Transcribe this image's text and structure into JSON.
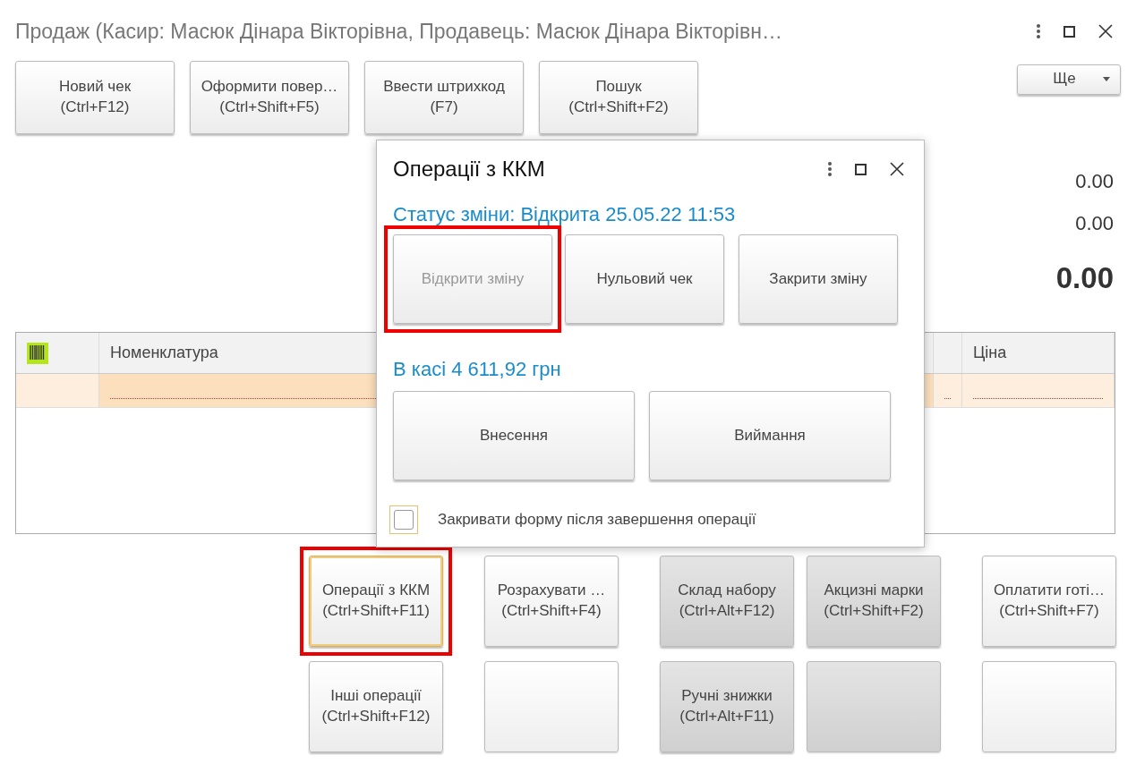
{
  "window": {
    "title": "Продаж (Касир: Масюк Дінара Вікторівна, Продавець: Масюк Дінара Вікторівн…"
  },
  "toolbar": {
    "buttons": [
      {
        "label": "Новий чек",
        "shortcut": "(Ctrl+F12)"
      },
      {
        "label": "Оформити повер…",
        "shortcut": "(Ctrl+Shift+F5)"
      },
      {
        "label": "Ввести штрихкод",
        "shortcut": "(F7)"
      },
      {
        "label": "Пошук",
        "shortcut": "(Ctrl+Shift+F2)"
      }
    ],
    "more": {
      "label": "Ще"
    }
  },
  "totals": [
    {
      "value": "0.00",
      "kind": "normal"
    },
    {
      "value": "0.00",
      "kind": "normal"
    },
    {
      "value": "0.00",
      "kind": "total"
    }
  ],
  "table": {
    "columns": [
      {
        "kind": "icon"
      },
      {
        "kind": "text",
        "label": "Номенклатура"
      },
      {
        "kind": "blank"
      },
      {
        "kind": "text",
        "label": "Ціна"
      }
    ],
    "rows": [
      {
        "selected": true,
        "required": true
      }
    ]
  },
  "actions": [
    {
      "kind": "button",
      "label": "Операції з ККМ",
      "shortcut": "(Ctrl+Shift+F11)",
      "shaded": false,
      "focused": true,
      "highlighted": true
    },
    {
      "kind": "button",
      "label": "Розрахувати …",
      "shortcut": "(Ctrl+Shift+F4)",
      "shaded": false,
      "focused": false,
      "highlighted": false
    },
    {
      "kind": "button",
      "label": "Склад набору",
      "shortcut": "(Ctrl+Alt+F12)",
      "shaded": true,
      "focused": false,
      "highlighted": false
    },
    {
      "kind": "button",
      "label": "Акцизні марки",
      "shortcut": "(Ctrl+Shift+F2)",
      "shaded": true,
      "focused": false,
      "highlighted": false
    },
    {
      "kind": "button",
      "label": "Оплатити готі…",
      "shortcut": "(Ctrl+Shift+F7)",
      "shaded": false,
      "focused": false,
      "highlighted": false
    },
    {
      "kind": "button",
      "label": "Інші операції",
      "shortcut": "(Ctrl+Shift+F12)",
      "shaded": false,
      "focused": false,
      "highlighted": false
    },
    {
      "kind": "empty",
      "shaded": false
    },
    {
      "kind": "button",
      "label": "Ручні знижки",
      "shortcut": "(Ctrl+Alt+F11)",
      "shaded": true,
      "focused": false,
      "highlighted": false
    },
    {
      "kind": "empty",
      "shaded": true
    },
    {
      "kind": "empty",
      "shaded": false
    }
  ],
  "dialog": {
    "title": "Операції з ККМ",
    "status": "Статус зміни: Відкрита 25.05.22 11:53",
    "shift_buttons": [
      {
        "label": "Відкрити зміну",
        "disabled": true,
        "highlighted": true
      },
      {
        "label": "Нульовий чек",
        "disabled": false,
        "highlighted": false
      },
      {
        "label": "Закрити зміну",
        "disabled": false,
        "highlighted": false
      }
    ],
    "cash": "В касі 4 611,92 грн",
    "cash_buttons": [
      {
        "label": "Внесення"
      },
      {
        "label": "Виймання"
      }
    ],
    "close_after": {
      "label": "Закривати форму після завершення операції",
      "checked": false
    }
  }
}
